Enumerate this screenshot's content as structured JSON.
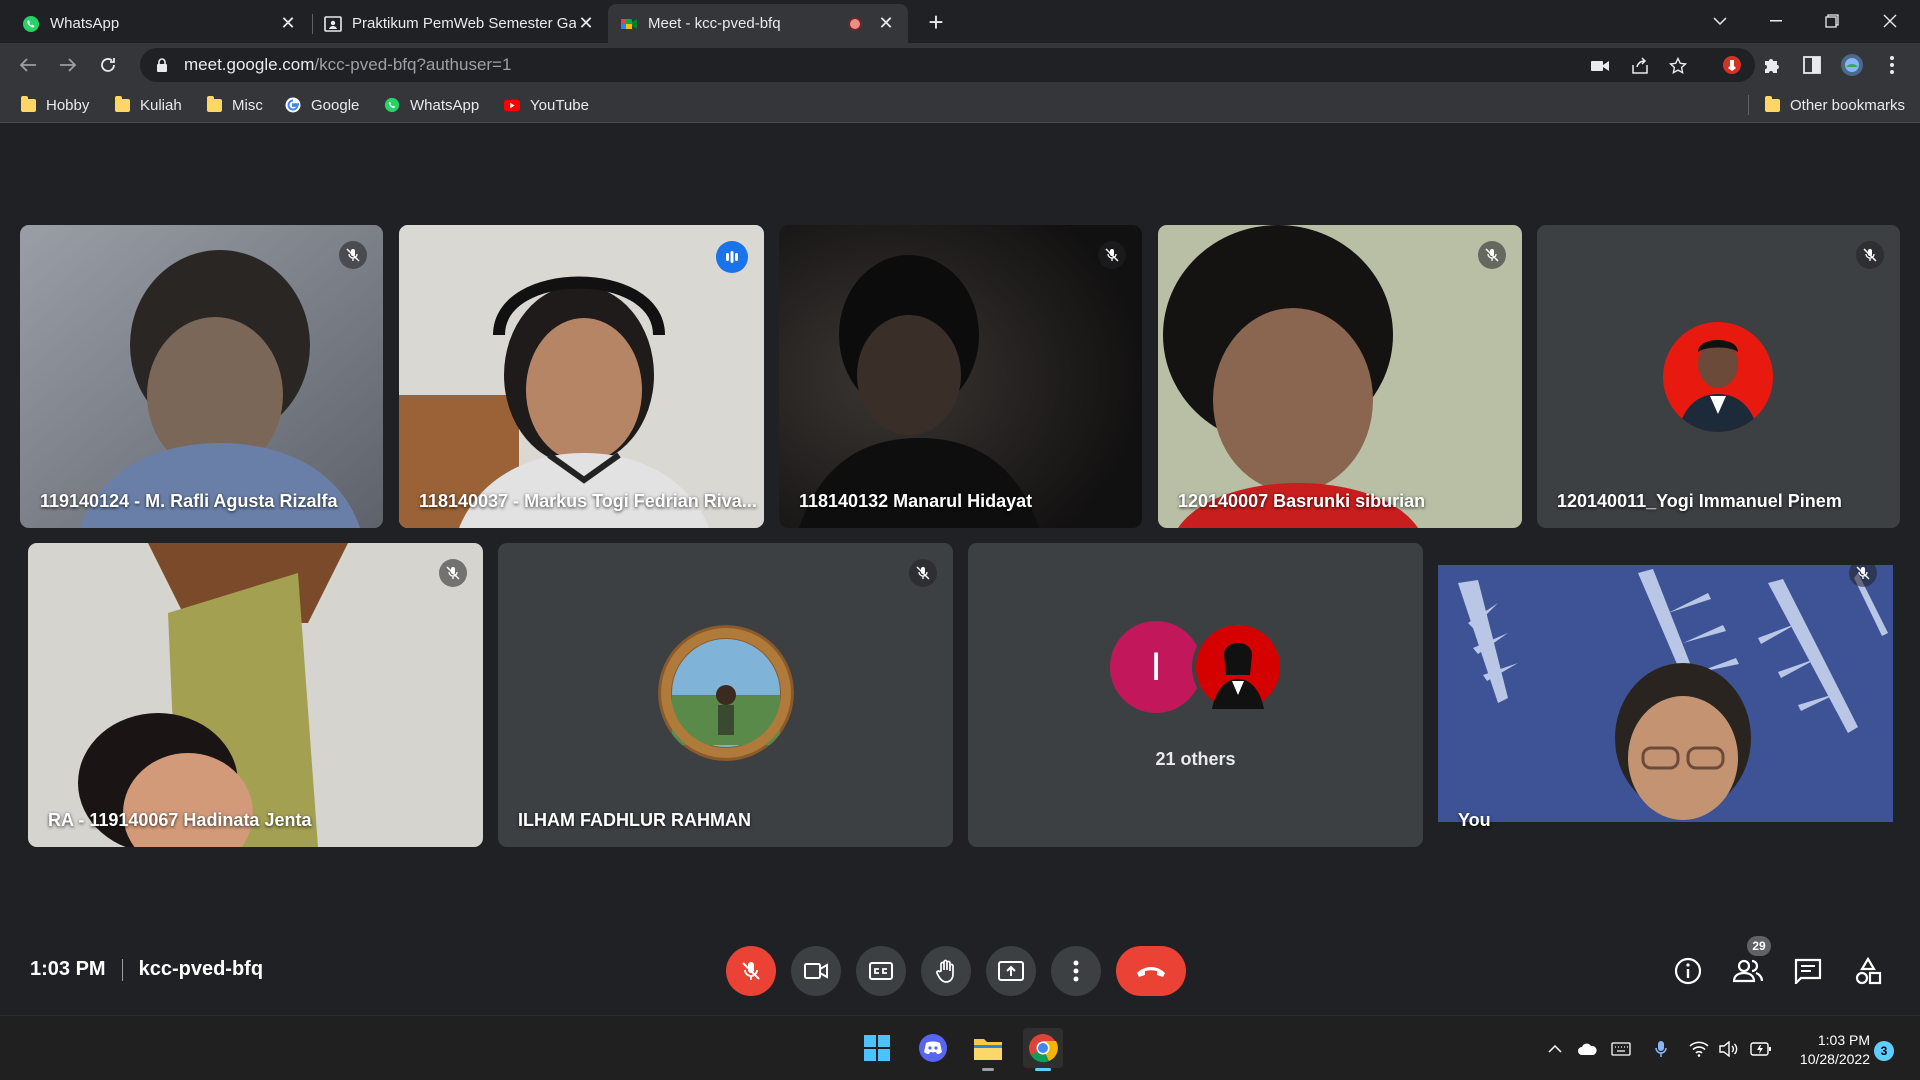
{
  "browser": {
    "tabs": [
      {
        "title": "WhatsApp",
        "icon": "whatsapp-icon"
      },
      {
        "title": "Praktikum PemWeb Semester Ga",
        "icon": "classroom-icon"
      },
      {
        "title": "Meet - kcc-pved-bfq",
        "icon": "meet-icon",
        "recording": true
      }
    ],
    "url_host": "meet.google.com",
    "url_path": "/kcc-pved-bfq?authuser=1",
    "bookmarks": [
      {
        "label": "Hobby",
        "icon": "folder-icon"
      },
      {
        "label": "Kuliah",
        "icon": "folder-icon"
      },
      {
        "label": "Misc",
        "icon": "folder-icon"
      },
      {
        "label": "Google",
        "icon": "google-icon"
      },
      {
        "label": "WhatsApp",
        "icon": "whatsapp-icon"
      },
      {
        "label": "YouTube",
        "icon": "youtube-icon"
      }
    ],
    "other_bookmarks": "Other bookmarks"
  },
  "meet": {
    "tiles": [
      {
        "name": "119140124 - M. Rafli Agusta Rizalfa",
        "muted": true
      },
      {
        "name": "118140037 - Markus Togi Fedrian Riva...",
        "speaking": true
      },
      {
        "name": "118140132 Manarul Hidayat",
        "muted": true
      },
      {
        "name": "120140007 Basrunki siburian",
        "muted": true
      },
      {
        "name": "120140011_Yogi Immanuel Pinem",
        "muted": true
      },
      {
        "name": "RA - 119140067 Hadinata Jenta",
        "muted": true
      },
      {
        "name": "ILHAM FADHLUR RAHMAN",
        "muted": true
      },
      {
        "name": "You",
        "muted": true
      }
    ],
    "others": {
      "initial": "I",
      "label": "21 others"
    },
    "time": "1:03 PM",
    "meeting_code": "kcc-pved-bfq",
    "participant_count": "29"
  },
  "taskbar": {
    "time": "1:03 PM",
    "date": "10/28/2022",
    "notifications": "3"
  },
  "colors": {
    "meet_bg": "#202124",
    "tile_bg": "#3c4043",
    "danger": "#ea4335",
    "active_speaker": "#8ab4f8"
  }
}
